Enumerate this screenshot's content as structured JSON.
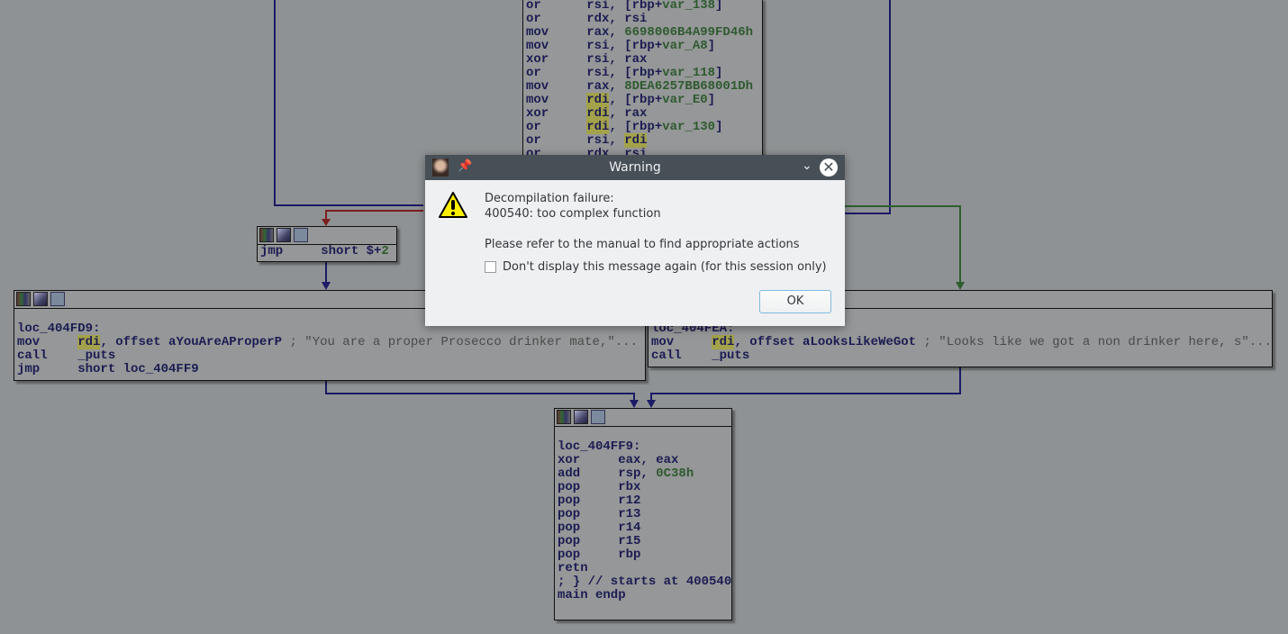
{
  "graph": {
    "nodes": [
      {
        "id": "top",
        "has_header": false,
        "lines": [
          [
            [
              "or      rsi, [rbp+",
              ""
            ],
            [
              "var_138",
              "var"
            ],
            [
              "]",
              ""
            ]
          ],
          [
            [
              "or      rdx, rsi",
              ""
            ]
          ],
          [
            [
              "mov     rax, ",
              ""
            ],
            [
              "6698006B4A99FD46h",
              "num"
            ]
          ],
          [
            [
              "mov     rsi, [rbp+",
              ""
            ],
            [
              "var_A8",
              "var"
            ],
            [
              "]",
              ""
            ]
          ],
          [
            [
              "xor     rsi, rax",
              ""
            ]
          ],
          [
            [
              "or      rsi, [rbp+",
              ""
            ],
            [
              "var_118",
              "var"
            ],
            [
              "]",
              ""
            ]
          ],
          [
            [
              "mov     rax, ",
              ""
            ],
            [
              "8DEA6257BB68001Dh",
              "num"
            ]
          ],
          [
            [
              "mov     ",
              ""
            ],
            [
              "rdi",
              "hl"
            ],
            [
              ", [rbp+",
              ""
            ],
            [
              "var_E0",
              "var"
            ],
            [
              "]",
              ""
            ]
          ],
          [
            [
              "xor     ",
              ""
            ],
            [
              "rdi",
              "hl"
            ],
            [
              ", rax",
              ""
            ]
          ],
          [
            [
              "or      ",
              ""
            ],
            [
              "rdi",
              "hl"
            ],
            [
              ", [rbp+",
              ""
            ],
            [
              "var_130",
              "var"
            ],
            [
              "]",
              ""
            ]
          ],
          [
            [
              "or      rsi, ",
              ""
            ],
            [
              "rdi",
              "hl"
            ]
          ],
          [
            [
              "or      rdx, rsi",
              ""
            ]
          ]
        ]
      },
      {
        "id": "jmp",
        "has_header": true,
        "lines": [
          [
            [
              "jmp     short $+",
              ""
            ],
            [
              "2",
              "num"
            ]
          ]
        ]
      },
      {
        "id": "left",
        "has_header": true,
        "lines": [
          [
            [
              "",
              ""
            ]
          ],
          [
            [
              "loc_404FD9:",
              ""
            ]
          ],
          [
            [
              "mov     ",
              ""
            ],
            [
              "rdi",
              "hl"
            ],
            [
              ", offset aYouAreAProperP ",
              ""
            ],
            [
              "; \"You are a proper Prosecco drinker mate,\"...",
              "cmt"
            ]
          ],
          [
            [
              "call    _puts",
              ""
            ]
          ],
          [
            [
              "jmp     short loc_404FF9",
              ""
            ]
          ]
        ]
      },
      {
        "id": "right",
        "has_header": true,
        "lines": [
          [
            [
              "",
              ""
            ]
          ],
          [
            [
              "loc_404FEA:",
              ""
            ]
          ],
          [
            [
              "mov     ",
              ""
            ],
            [
              "rdi",
              "hl"
            ],
            [
              ", offset aLooksLikeWeGot ",
              ""
            ],
            [
              "; \"Looks like we got a non drinker here, s\"...",
              "cmt"
            ]
          ],
          [
            [
              "call    _puts",
              ""
            ]
          ]
        ]
      },
      {
        "id": "bottom",
        "has_header": true,
        "lines": [
          [
            [
              "",
              ""
            ]
          ],
          [
            [
              "loc_404FF9:",
              ""
            ]
          ],
          [
            [
              "xor     eax, eax",
              ""
            ]
          ],
          [
            [
              "add     rsp, ",
              ""
            ],
            [
              "0C38h",
              "num"
            ]
          ],
          [
            [
              "pop     rbx",
              ""
            ]
          ],
          [
            [
              "pop     r12",
              ""
            ]
          ],
          [
            [
              "pop     r13",
              ""
            ]
          ],
          [
            [
              "pop     r14",
              ""
            ]
          ],
          [
            [
              "pop     r15",
              ""
            ]
          ],
          [
            [
              "pop     rbp",
              ""
            ]
          ],
          [
            [
              "retn",
              ""
            ]
          ],
          [
            [
              "; } // starts at 400540",
              ""
            ]
          ],
          [
            [
              "main endp",
              ""
            ]
          ]
        ]
      }
    ],
    "edge_colors": {
      "normal": "#1b1b66",
      "true": "#2e5e2e",
      "false": "#7a1e1e"
    }
  },
  "dialog": {
    "title": "Warning",
    "line1": "Decompilation failure:",
    "line2": "400540: too complex function",
    "line3": "Please refer to the manual to find appropriate actions",
    "checkbox_label": "Don't display this message again (for this session only)",
    "checkbox_checked": false,
    "ok_label": "OK",
    "pin_icon": "📌",
    "close_icon": "✕",
    "minimize_icon": "⌄"
  }
}
